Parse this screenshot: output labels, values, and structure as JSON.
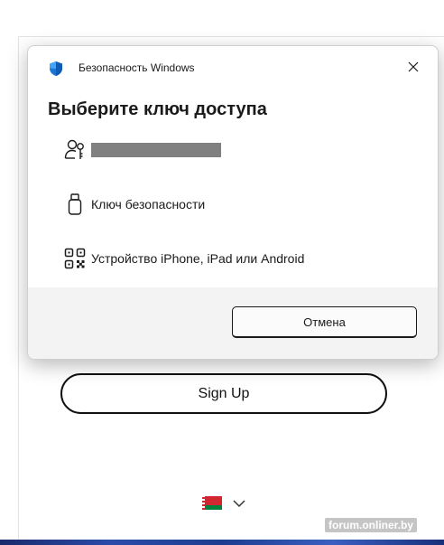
{
  "background_page": {
    "signup_label": "Sign Up"
  },
  "dialog": {
    "title": "Безопасность Windows",
    "heading": "Выберите ключ доступа",
    "options": [
      {
        "label": "",
        "icon": "user-key-icon"
      },
      {
        "label": "Ключ безопасности",
        "icon": "usb-key-icon"
      },
      {
        "label": "Устройство iPhone, iPad или Android",
        "icon": "qr-code-icon"
      }
    ],
    "cancel_label": "Отмена",
    "shield_icon": "windows-security-shield-icon",
    "close_icon": "close-icon"
  },
  "watermark": "forum.onliner.by",
  "colors": {
    "shield_blue": "#1976d2",
    "redacted_gray": "#808080",
    "footer_gray": "#f3f3f3",
    "flag_red": "#d22730",
    "flag_green": "#00843d"
  }
}
